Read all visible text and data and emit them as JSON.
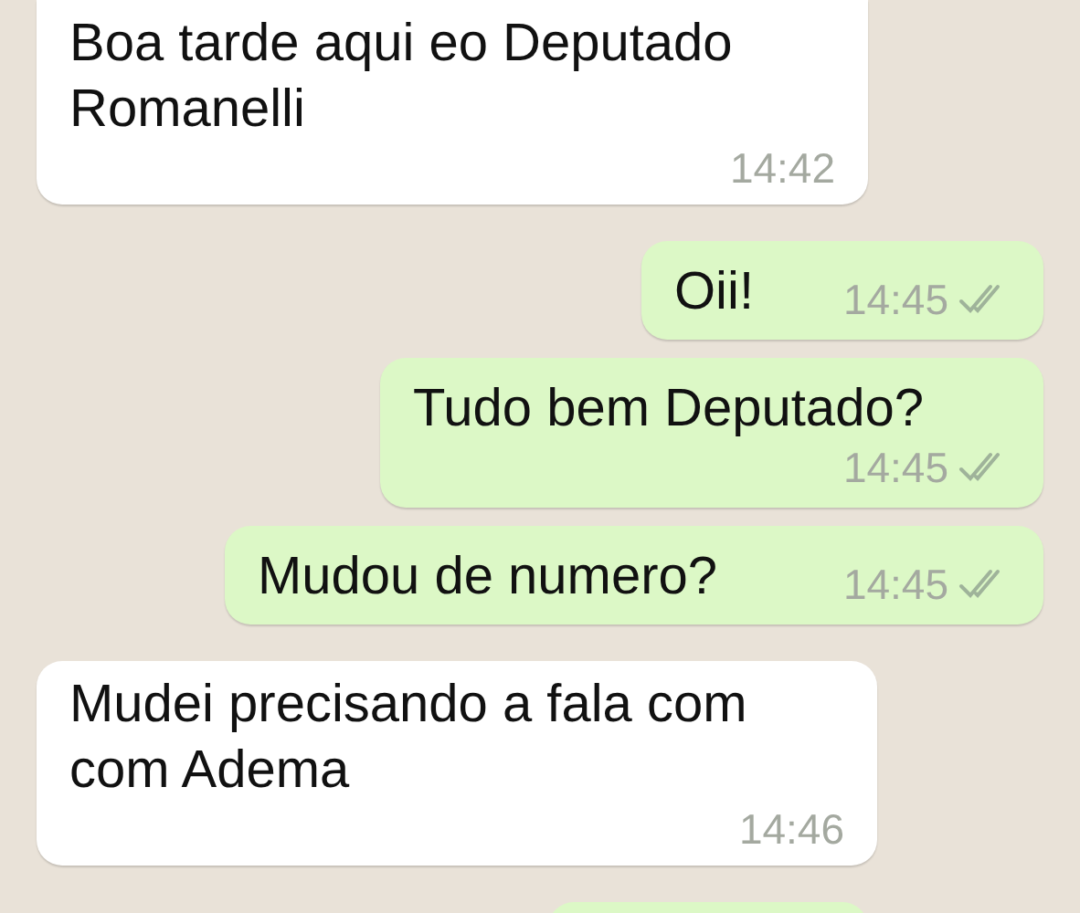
{
  "messages": [
    {
      "kind": "incoming",
      "text": "Boa tarde aqui eo Deputado Romanelli",
      "time": "14:42",
      "cut_off": false
    },
    {
      "kind": "outgoing",
      "text": "Oii!",
      "time": "14:45",
      "read": false,
      "cut_off": false
    },
    {
      "kind": "outgoing",
      "text": "Tudo bem Deputado?",
      "time": "14:45",
      "read": false,
      "cut_off": false
    },
    {
      "kind": "outgoing",
      "text": "Mudou de numero?",
      "time": "14:45",
      "read": false,
      "cut_off": false
    },
    {
      "kind": "incoming",
      "text": "Mudei precisando a fala com com Adema",
      "time": "14:46",
      "cut_off": false
    },
    {
      "kind": "outgoing",
      "cut_off": true
    }
  ]
}
